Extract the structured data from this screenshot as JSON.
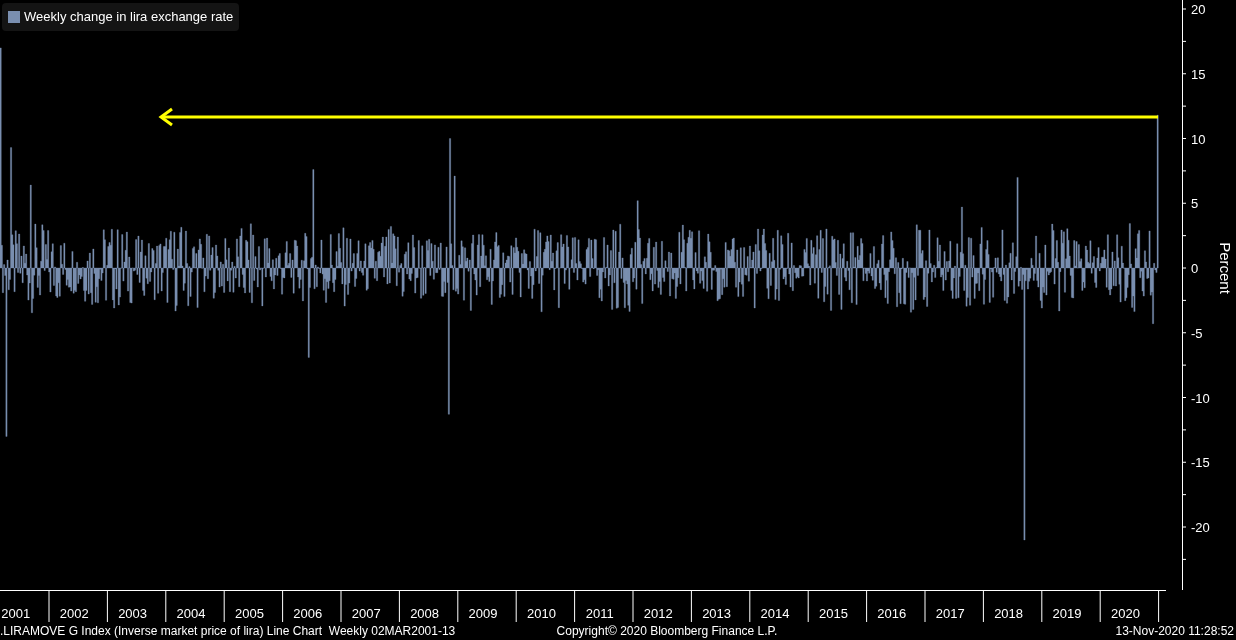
{
  "legend": {
    "label": "Weekly change in lira exchange rate"
  },
  "y_axis": {
    "label": "Percent",
    "ticks": [
      "20",
      "15",
      "10",
      "5",
      "0",
      "-5",
      "-10",
      "-15",
      "-20"
    ]
  },
  "x_axis": {
    "labels": [
      "2001",
      "2002",
      "2003",
      "2004",
      "2005",
      "2006",
      "2007",
      "2008",
      "2009",
      "2010",
      "2011",
      "2012",
      "2013",
      "2014",
      "2015",
      "2016",
      "2017",
      "2018",
      "2019",
      "2020"
    ]
  },
  "footer": {
    "description": ".LIRAMOVE G Index (Inverse market price of lira) Line Chart  Weekly 02MAR2001-13",
    "copyright": "Copyright© 2020 Bloomberg Finance L.P.",
    "timestamp": "13-Nov-2020 11:28:52"
  }
}
